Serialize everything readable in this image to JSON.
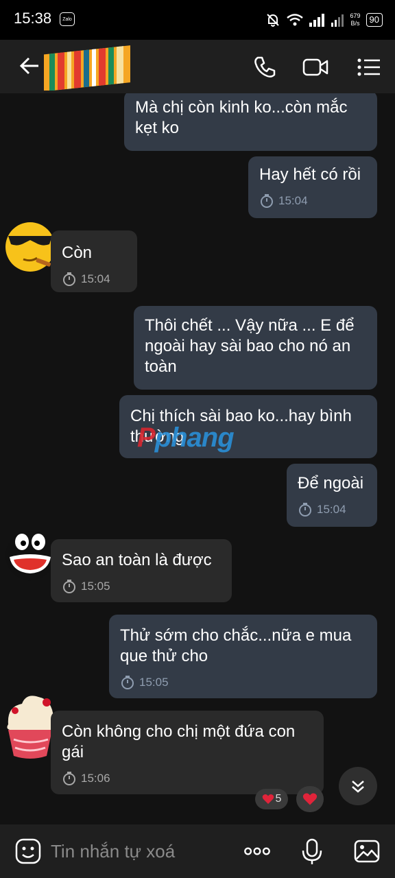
{
  "status_bar": {
    "time": "15:38",
    "app_badge": "Zalo",
    "net_speed_value": "679",
    "net_speed_unit": "B/s",
    "battery": "90"
  },
  "header": {
    "back_icon": "arrow-left-icon",
    "call_icon": "phone-icon",
    "video_icon": "video-camera-icon",
    "menu_icon": "list-icon"
  },
  "messages": [
    {
      "side": "out",
      "text": "Mà chị còn kinh ko...còn mắc kẹt ko",
      "time": ""
    },
    {
      "side": "out",
      "text": "Hay hết có rồi",
      "time": "15:04"
    },
    {
      "side": "in",
      "text": "Còn",
      "time": "15:04"
    },
    {
      "side": "out",
      "text": "Thôi chết ... Vậy nữa ... E để ngoài hay sài bao cho nó an toàn",
      "time": ""
    },
    {
      "side": "out",
      "text": "Chị thích sài bao ko...hay bình thường",
      "time": ""
    },
    {
      "side": "out",
      "text": "Để ngoài",
      "time": "15:04"
    },
    {
      "side": "in",
      "text": "Sao an toàn là được",
      "time": "15:05"
    },
    {
      "side": "out",
      "text": "Thử sớm cho chắc...nữa e mua que thử cho",
      "time": "15:05"
    },
    {
      "side": "in",
      "text": "Còn không cho chị một đứa con gái",
      "time": "15:06"
    }
  ],
  "watermark": "phang",
  "reactions": {
    "heart_count": "5",
    "icon": "heart-icon"
  },
  "input": {
    "placeholder": "Tin nhắn tự xoá",
    "emoji_icon": "emoji-icon",
    "more_icon": "more-dots-icon",
    "mic_icon": "microphone-icon",
    "image_icon": "image-icon"
  },
  "colors": {
    "outgoing_bubble": "#333b47",
    "incoming_bubble": "#2a2a2a",
    "chat_background": "#121212",
    "header_background": "#1f1f1f"
  }
}
